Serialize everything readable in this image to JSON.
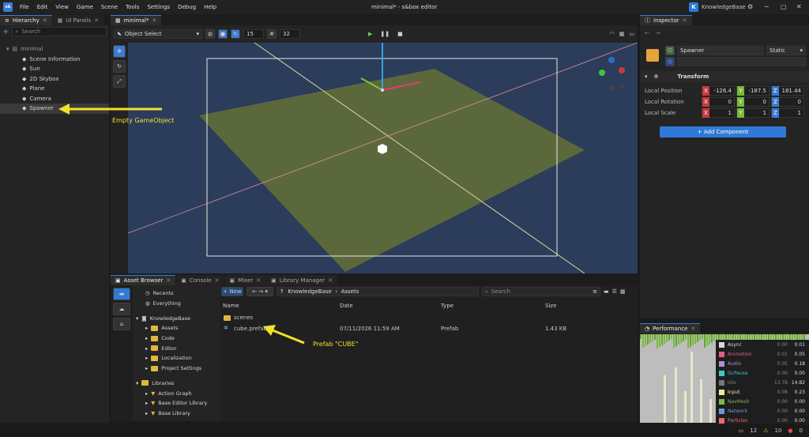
{
  "menubar": {
    "items": [
      "File",
      "Edit",
      "View",
      "Game",
      "Scene",
      "Tools",
      "Settings",
      "Debug",
      "Help"
    ],
    "title": "minimal* - s&box editor",
    "user": "KnowledgeBase",
    "user_initial": "K",
    "logo": "s&"
  },
  "hierarchy": {
    "tabs": [
      "Hierarchy",
      "UI Panels"
    ],
    "search_placeholder": "Search",
    "root": "minimal",
    "items": [
      "Scene Information",
      "Sun",
      "2D Skybox",
      "Plane",
      "Camera",
      "Spawner"
    ],
    "selected": "Spawner"
  },
  "viewport": {
    "tab": "minimal*",
    "mode": "Object Select",
    "grid": "15",
    "snap": "32"
  },
  "annotations": {
    "spawner_note": "Empty GameObject",
    "prefab_note": "Prefab \"CUBE\""
  },
  "inspector": {
    "tab": "Inspector",
    "name": "Spawner",
    "static_label": "Static",
    "component": "Transform",
    "rows": [
      {
        "label": "Local Position",
        "values": [
          "-126.4",
          "-187.5",
          "181.44"
        ]
      },
      {
        "label": "Local Rotation",
        "values": [
          "0",
          "0",
          "0"
        ]
      },
      {
        "label": "Local Scale",
        "values": [
          "1",
          "1",
          "1"
        ]
      }
    ],
    "add_button": "+ Add Component"
  },
  "bottom": {
    "tabs": [
      "Asset Browser",
      "Console",
      "Mixer",
      "Library Manager"
    ]
  },
  "assets": {
    "new_label": "New",
    "path": [
      "KnowledgeBase",
      "Assets"
    ],
    "search_placeholder": "Search",
    "tree_top": [
      "Recents",
      "Everything"
    ],
    "project": "KnowledgeBase",
    "project_children": [
      "Assets",
      "Code",
      "Editor",
      "Localization",
      "Project Settings"
    ],
    "libraries": "Libraries",
    "library_children": [
      "Action Graph",
      "Base Editor Library",
      "Base Library"
    ],
    "columns": [
      "Name",
      "Date",
      "Type",
      "Size"
    ],
    "rows": [
      {
        "name": "scenes",
        "date": "",
        "type": "",
        "size": ""
      },
      {
        "name": "cube.prefab",
        "date": "07/11/2026 11:59 AM",
        "type": "Prefab",
        "size": "1.43 KB"
      }
    ]
  },
  "performance": {
    "tab": "Performance",
    "rows": [
      {
        "name": "Async",
        "v1": "0.00",
        "v2": "0.01",
        "color": "#d8d8d8"
      },
      {
        "name": "Animation",
        "v1": "0.01",
        "v2": "0.05",
        "color": "#e85a8c"
      },
      {
        "name": "Audio",
        "v1": "0.05",
        "v2": "0.18",
        "color": "#b58ad8"
      },
      {
        "name": "GcPause",
        "v1": "0.00",
        "v2": "0.00",
        "color": "#3fc8c8"
      },
      {
        "name": "Idle",
        "v1": "13.78",
        "v2": "14.82",
        "color": "#777777"
      },
      {
        "name": "Input",
        "v1": "0.08",
        "v2": "0.23",
        "color": "#e8e8a0"
      },
      {
        "name": "NavMesh",
        "v1": "0.00",
        "v2": "0.00",
        "color": "#7ab84a"
      },
      {
        "name": "Network",
        "v1": "0.00",
        "v2": "0.00",
        "color": "#6a9ad8"
      },
      {
        "name": "Particles",
        "v1": "0.00",
        "v2": "0.00",
        "color": "#e86a6a"
      }
    ]
  },
  "statusbar": {
    "messages": "12",
    "warnings": "10",
    "errors": "0"
  }
}
